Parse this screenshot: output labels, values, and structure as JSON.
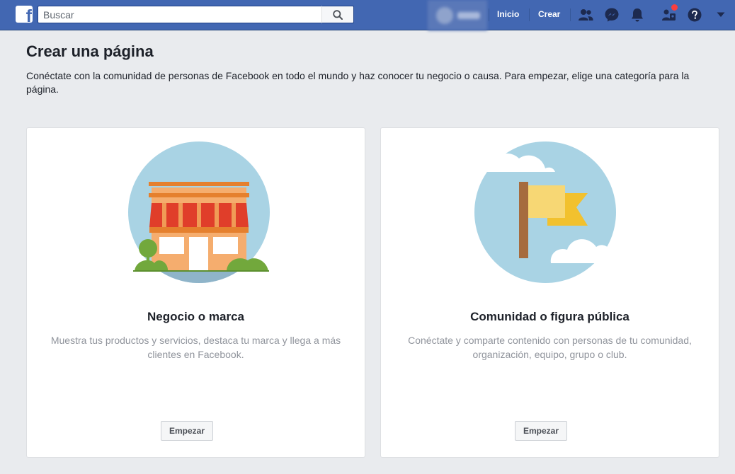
{
  "header": {
    "logo_letter": "f",
    "search_placeholder": "Buscar",
    "nav": {
      "home": "Inicio",
      "create": "Crear"
    },
    "icons": [
      "friends-icon",
      "messenger-icon",
      "notifications-icon",
      "groups-icon",
      "help-icon",
      "dropdown-icon"
    ],
    "brand_color": "#4267b2"
  },
  "main": {
    "title": "Crear una página",
    "description": "Conéctate con la comunidad de personas de Facebook en todo el mundo y haz conocer tu negocio o causa. Para empezar, elige una categoría para la página."
  },
  "cards": [
    {
      "illustration": "storefront-illustration",
      "title": "Negocio o marca",
      "description": "Muestra tus productos y servicios, destaca tu marca y llega a más clientes en Facebook.",
      "button": "Empezar"
    },
    {
      "illustration": "flag-illustration",
      "title": "Comunidad o figura pública",
      "description": "Conéctate y comparte contenido con personas de tu comunidad, organización, equipo, grupo o club.",
      "button": "Empezar"
    }
  ]
}
